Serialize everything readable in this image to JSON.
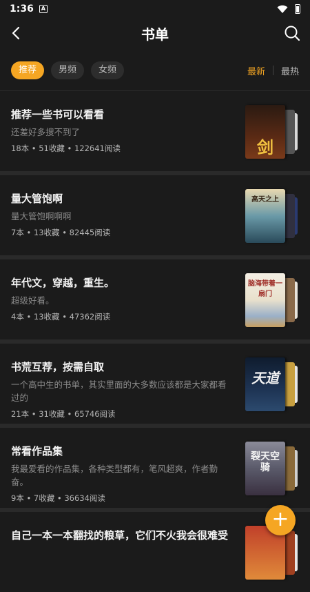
{
  "status": {
    "time": "1:36",
    "notif": "A"
  },
  "header": {
    "title": "书单"
  },
  "filters": {
    "chips": [
      "推荐",
      "男频",
      "女频"
    ],
    "sort_latest": "最新",
    "sort_hot": "最热"
  },
  "booklists": [
    {
      "title": "推荐一些书可以看看",
      "desc": "还差好多搜不到了",
      "meta": "18本 • 51收藏 • 122641阅读",
      "cover_text": "剑",
      "cover_colors": [
        "#2a1a12",
        "#7a3a1a"
      ]
    },
    {
      "title": "量大管饱啊",
      "desc": "量大管饱啊啊啊",
      "meta": "7本 • 13收藏 • 82445阅读",
      "cover_text": "高天之上",
      "cover_colors": [
        "#d8c8a0",
        "#3a6a7a"
      ]
    },
    {
      "title": "年代文，穿越，重生。",
      "desc": "超级好看。",
      "meta": "4本 • 13收藏 • 47362阅读",
      "cover_text": "脑海带着一扇门",
      "cover_colors": [
        "#f2ece0",
        "#9ab0c8"
      ]
    },
    {
      "title": "书荒互荐，按需自取",
      "desc": "一个高中生的书单，其实里面的大多数应该都是大家都看过的",
      "meta": "21本 • 31收藏 • 65746阅读",
      "cover_text": "天道",
      "cover_colors": [
        "#0f1c2e",
        "#2c4a6e"
      ]
    },
    {
      "title": "常看作品集",
      "desc": "我最爱看的作品集，各种类型都有，笔风超爽，作者勤奋。",
      "meta": "9本 • 7收藏 • 36634阅读",
      "cover_text": "裂天空骑",
      "cover_colors": [
        "#6a6a78",
        "#3a3040"
      ]
    },
    {
      "title": "自己一本一本翻找的粮草，它们不火我会很难受",
      "desc": "",
      "meta": "",
      "cover_text": "",
      "cover_colors": [
        "#c0402a",
        "#e08a3a"
      ]
    }
  ],
  "fab": {
    "label": "+"
  }
}
